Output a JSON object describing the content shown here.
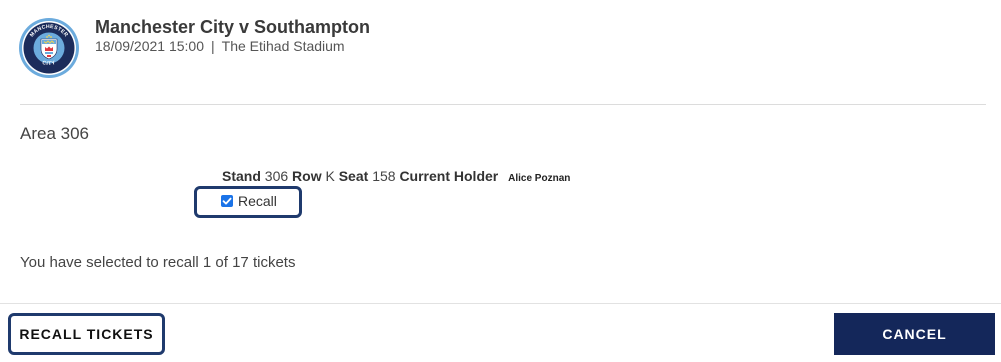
{
  "event": {
    "title": "Manchester City v Southampton",
    "date_time": "18/09/2021 15:00",
    "separator": "|",
    "venue": "The Etihad Stadium",
    "crest_icon": "manchester-city-crest-icon",
    "crest_text_top": "MANCHESTER",
    "crest_text_bottom": "CITY"
  },
  "area": {
    "title": "Area 306"
  },
  "ticket": {
    "stand_label": "Stand",
    "stand_value": "306",
    "row_label": "Row",
    "row_value": "K",
    "seat_label": "Seat",
    "seat_value": "158",
    "holder_label": "Current Holder",
    "holder_name": "Alice Poznan",
    "recall_label": "Recall",
    "recall_checked": true
  },
  "summary": {
    "text": "You have selected to recall 1 of 17 tickets"
  },
  "actions": {
    "recall_label": "RECALL TICKETS",
    "cancel_label": "CANCEL"
  },
  "colors": {
    "brand_navy": "#14275a",
    "highlight_border": "#1f3a6d",
    "crest_sky_blue": "#6cabdd",
    "checkbox_blue": "#1a73e8"
  }
}
